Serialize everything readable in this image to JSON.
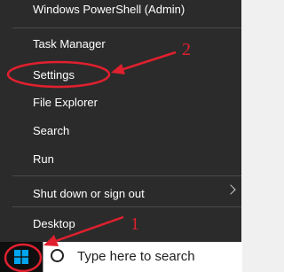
{
  "context_menu": {
    "items": [
      {
        "label": "Windows PowerShell (Admin)"
      },
      {
        "label": "Task Manager"
      },
      {
        "label": "Settings"
      },
      {
        "label": "File Explorer"
      },
      {
        "label": "Search"
      },
      {
        "label": "Run"
      },
      {
        "label": "Shut down or sign out"
      },
      {
        "label": "Desktop"
      }
    ]
  },
  "taskbar": {
    "start_icon": "windows-logo-icon",
    "search_placeholder": "Type here to search"
  },
  "annotations": {
    "color": "#e0202e",
    "label_1": "1",
    "label_2": "2"
  },
  "colors": {
    "menu_background": "#2b2b2b",
    "menu_text": "#ffffff",
    "windows_blue": "#00a4ef"
  }
}
